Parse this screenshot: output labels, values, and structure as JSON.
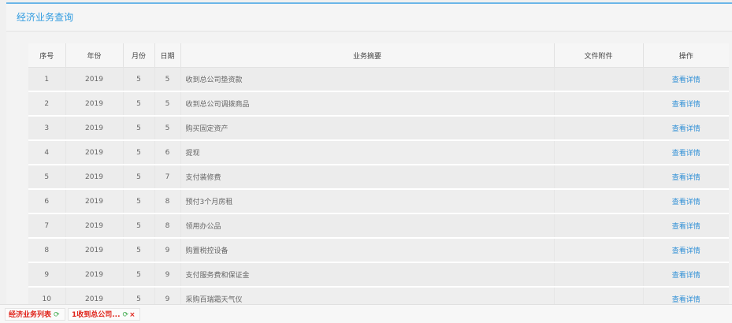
{
  "panel": {
    "title": "经济业务查询"
  },
  "table": {
    "headers": [
      "序号",
      "年份",
      "月份",
      "日期",
      "业务摘要",
      "文件附件",
      "操作"
    ],
    "rows": [
      {
        "no": "1",
        "year": "2019",
        "month": "5",
        "day": "5",
        "summary": "收到总公司垫资款",
        "attachment": "",
        "action": "查看详情"
      },
      {
        "no": "2",
        "year": "2019",
        "month": "5",
        "day": "5",
        "summary": "收到总公司调拨商品",
        "attachment": "",
        "action": "查看详情"
      },
      {
        "no": "3",
        "year": "2019",
        "month": "5",
        "day": "5",
        "summary": "购买固定资产",
        "attachment": "",
        "action": "查看详情"
      },
      {
        "no": "4",
        "year": "2019",
        "month": "5",
        "day": "6",
        "summary": "提现",
        "attachment": "",
        "action": "查看详情"
      },
      {
        "no": "5",
        "year": "2019",
        "month": "5",
        "day": "7",
        "summary": "支付装修费",
        "attachment": "",
        "action": "查看详情"
      },
      {
        "no": "6",
        "year": "2019",
        "month": "5",
        "day": "8",
        "summary": "预付3个月房租",
        "attachment": "",
        "action": "查看详情"
      },
      {
        "no": "7",
        "year": "2019",
        "month": "5",
        "day": "8",
        "summary": "领用办公品",
        "attachment": "",
        "action": "查看详情"
      },
      {
        "no": "8",
        "year": "2019",
        "month": "5",
        "day": "9",
        "summary": "购置税控设备",
        "attachment": "",
        "action": "查看详情"
      },
      {
        "no": "9",
        "year": "2019",
        "month": "5",
        "day": "9",
        "summary": "支付服务费和保证金",
        "attachment": "",
        "action": "查看详情"
      },
      {
        "no": "10",
        "year": "2019",
        "month": "5",
        "day": "9",
        "summary": "采购百瑞霜天气仪",
        "attachment": "",
        "action": "查看详情"
      }
    ]
  },
  "tabs": [
    {
      "label": "经济业务列表",
      "refresh_icon": "⟳",
      "closable": false
    },
    {
      "label": "1收到总公司...",
      "refresh_icon": "⟳",
      "close_icon": "×",
      "closable": true
    }
  ],
  "colors": {
    "accent": "#2f9be0",
    "link": "#2f8fd6",
    "tab_text": "#e0241b",
    "refresh": "#3aa84a"
  }
}
